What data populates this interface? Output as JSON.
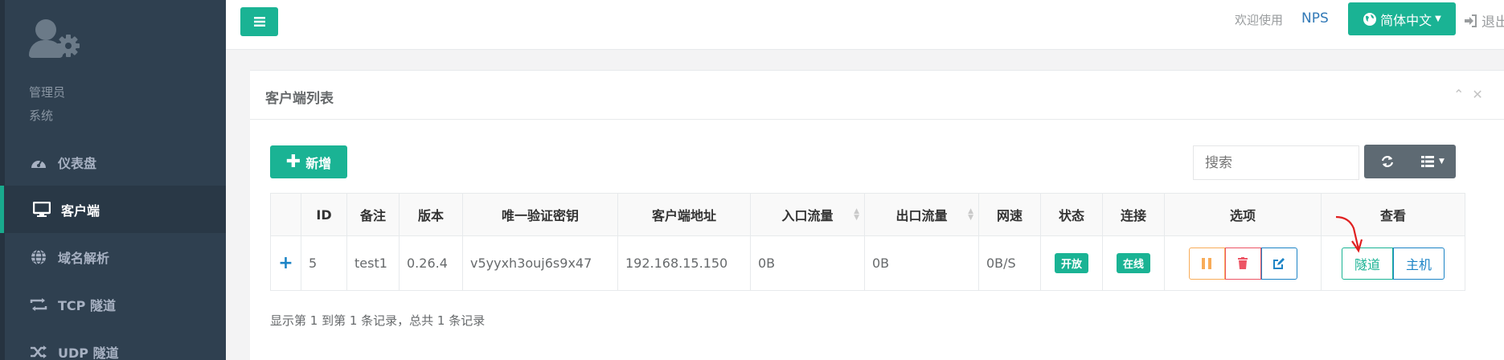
{
  "sidebar": {
    "profile": {
      "name": "管理员",
      "role": "系统"
    },
    "items": [
      {
        "label": "仪表盘",
        "icon": "dashboard-icon"
      },
      {
        "label": "客户端",
        "icon": "desktop-icon",
        "active": true
      },
      {
        "label": "域名解析",
        "icon": "globe-icon"
      },
      {
        "label": "TCP 隧道",
        "icon": "exchange-icon"
      },
      {
        "label": "UDP 隧道",
        "icon": "random-icon"
      }
    ]
  },
  "topbar": {
    "welcome": "欢迎使用",
    "brand": "NPS",
    "language": "简体中文",
    "logout": "退出"
  },
  "panel": {
    "title": "客户端列表",
    "add_label": "新增",
    "search_placeholder": "搜索",
    "columns": [
      "ID",
      "备注",
      "版本",
      "唯一验证密钥",
      "客户端地址",
      "入口流量",
      "出口流量",
      "网速",
      "状态",
      "连接",
      "选项",
      "查看"
    ],
    "rows": [
      {
        "id": "5",
        "remark": "test1",
        "version": "0.26.4",
        "vkey": "v5yyxh3ouj6s9x47",
        "addr": "192.168.15.150",
        "inlet_flow": "0B",
        "export_flow": "0B",
        "rate": "0B/S",
        "status": "开放",
        "connect": "在线",
        "view_tunnel": "隧道",
        "view_host": "主机"
      }
    ],
    "pagination_text": "显示第 1 到第 1 条记录，总共 1 条记录"
  },
  "colors": {
    "accent": "#1ab394",
    "sidebar": "#2f4050",
    "link": "#337ab7",
    "warning": "#f8ac59",
    "danger": "#ed5565",
    "primary": "#1c84c6"
  }
}
